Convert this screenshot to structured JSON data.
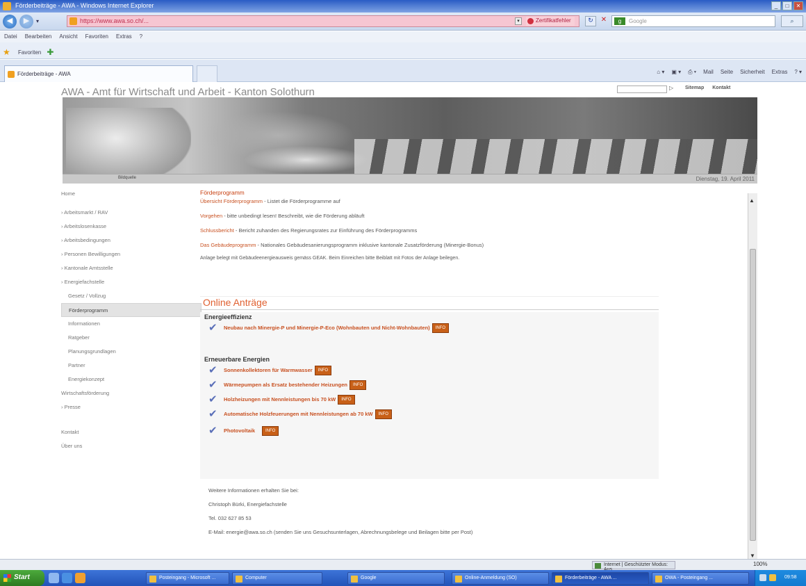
{
  "window": {
    "title": "Förderbeiträge - AWA - Windows Internet Explorer"
  },
  "address_bar": {
    "url": "https://www.awa.so.ch/...",
    "certificate_error": "Zertifikatfehler",
    "search_engine": "Google",
    "search_placeholder": "Google"
  },
  "menu": {
    "items": [
      "Datei",
      "Bearbeiten",
      "Ansicht",
      "Favoriten",
      "Extras",
      "?"
    ]
  },
  "favorites": {
    "label": "Favoriten"
  },
  "tabs": [
    {
      "label": "Förderbeiträge - AWA"
    }
  ],
  "command_bar": {
    "items": [
      "Mail",
      "Seite",
      "Sicherheit",
      "Extras"
    ]
  },
  "site": {
    "title": "AWA - Amt für Wirtschaft und Arbeit - Kanton Solothurn",
    "search_go": "▷",
    "links": [
      "Sitemap",
      "Kontakt"
    ],
    "banner_caption": "Bildquelle",
    "date": "Dienstag, 19. April 2011"
  },
  "nav": [
    {
      "label": "Home"
    },
    {
      "label": "Arbeitsmarkt / RAV"
    },
    {
      "label": "Arbeitslosenkasse"
    },
    {
      "label": "Arbeitsbedingungen"
    },
    {
      "label": "Personen Bewilligungen"
    },
    {
      "label": "Kantonale Amtsstelle"
    },
    {
      "label": "Energiefachstelle"
    },
    {
      "label": "Gesetz / Vollzug"
    },
    {
      "label": "Förderprogramm"
    },
    {
      "label": "Informationen"
    },
    {
      "label": "Ratgeber"
    },
    {
      "label": "Planungsgrundlagen"
    },
    {
      "label": "Partner"
    },
    {
      "label": "Energiekonzept"
    },
    {
      "label": "Wirtschaftsförderung"
    },
    {
      "label": "Presse"
    },
    {
      "label": "Kontakt"
    },
    {
      "label": "Über uns"
    }
  ],
  "main": {
    "heading": "Förderprogramm",
    "rows": [
      {
        "link": "Übersicht Förderprogramm",
        "text": " - Listet die Förderprogramme auf"
      },
      {
        "link": "Vorgehen",
        "text": " - bitte unbedingt lesen! Beschreibt, wie die Förderung abläuft"
      },
      {
        "link": "Schlussbericht",
        "text": " - Bericht zuhanden des Regierungsrates zur Einführung des Förderprogramms"
      },
      {
        "link": "Das Gebäudeprogramm",
        "text": " - Nationales Gebäudesanierungsprogramm inklusive kantonale Zusatzförderung (Minergie-Bonus)"
      }
    ],
    "note": "Anlage belegt mit Gebäudeenergieausweis gemäss GEAK. Beim Einreichen bitte Beiblatt mit Fotos der Anlage beilegen.",
    "online_title": "Online Anträge",
    "section1": "Energieeffizienz",
    "items1": [
      {
        "label": "Neubau nach Minergie-P und Minergie-P-Eco (Wohnbauten und Nicht-Wohnbauten)",
        "badge": "INFO"
      }
    ],
    "section2": "Erneuerbare Energien",
    "items2": [
      {
        "label": "Sonnenkollektoren für Warmwasser",
        "badge": "INFO"
      },
      {
        "label": "Wärmepumpen als Ersatz bestehender Heizungen",
        "badge": "INFO"
      },
      {
        "label": "Holzheizungen mit Nennleistungen bis 70 kW",
        "badge": "INFO"
      },
      {
        "label": "Automatische Holzfeuerungen mit Nennleistungen ab 70 kW",
        "badge": "INFO"
      },
      {
        "label": "Photovoltaik",
        "badge": "INFO"
      }
    ],
    "footer": [
      "Weitere Informationen erhalten Sie bei:",
      "Christoph Bürki, Energiefachstelle",
      "Tel. 032 627 85 53",
      "E-Mail: energie@awa.so.ch (senden Sie uns Gesuchsunterlagen, Abrechnungsbelege und Beilagen bitte per Post)"
    ]
  },
  "status": {
    "zone": "Internet | Geschützter Modus: Aus",
    "zoom": "100%"
  },
  "taskbar": {
    "start": "Start",
    "buttons": [
      "Posteingang - Microsoft ...",
      "Computer",
      "Google",
      "Online-Anmeldung (SO)",
      "Förderbeiträge - AWA ...",
      "OWA - Posteingang ..."
    ],
    "clock": "09:58"
  }
}
